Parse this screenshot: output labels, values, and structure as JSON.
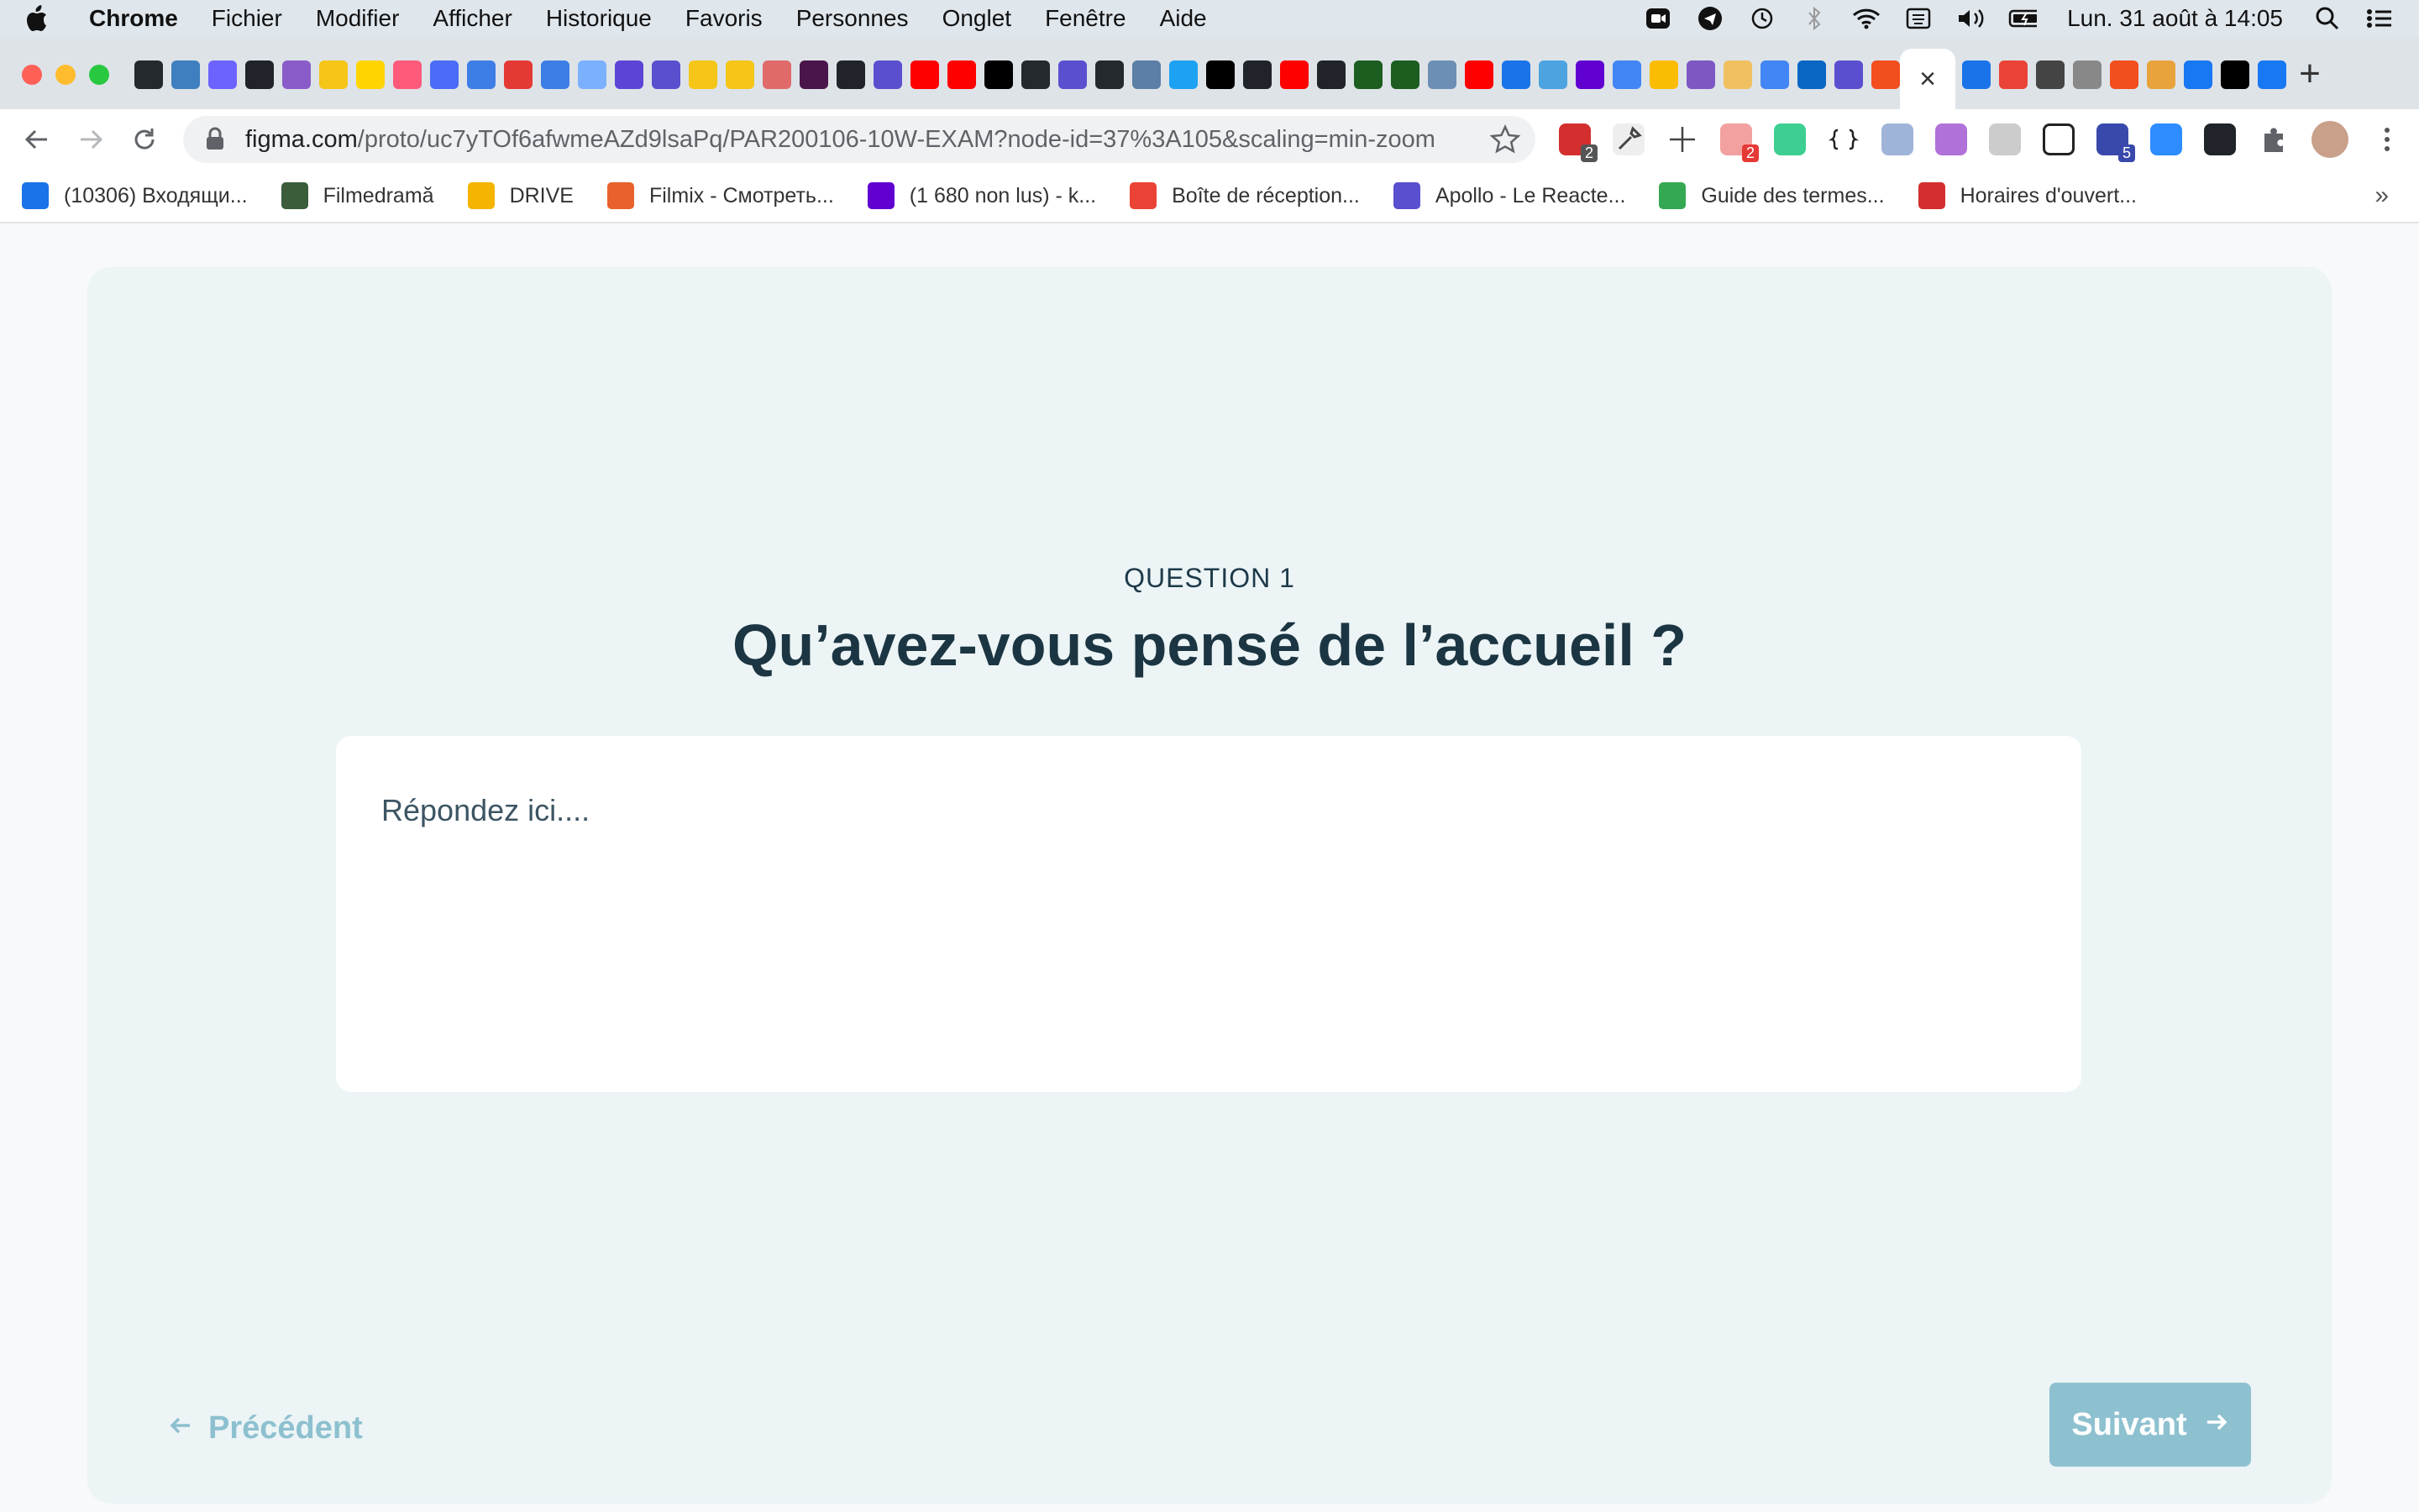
{
  "menubar": {
    "app_name": "Chrome",
    "items": [
      "Fichier",
      "Modifier",
      "Afficher",
      "Historique",
      "Favoris",
      "Personnes",
      "Onglet",
      "Fenêtre",
      "Aide"
    ],
    "clock": "Lun. 31 août à 14:05"
  },
  "browser": {
    "tab_close_glyph": "×",
    "new_tab_glyph": "+",
    "url_host": "figma.com",
    "url_path": "/proto/uc7yTOf6afwmeAZd9lsaPq/PAR200106-10W-EXAM?node-id=37%3A105&scaling=min-zoom",
    "ext_badges": [
      "2",
      "2",
      "5"
    ],
    "bookmarks_more": "»"
  },
  "bookmarks": [
    {
      "label": "(10306) Входящи...",
      "color": "#1a73e8"
    },
    {
      "label": "Filmedramă",
      "color": "#3b5d3a"
    },
    {
      "label": "DRIVE",
      "color": "#f4b400"
    },
    {
      "label": "Filmix - Смотреть...",
      "color": "#e8622c"
    },
    {
      "label": "(1 680 non lus) - k...",
      "color": "#6001d2"
    },
    {
      "label": "Boîte de réception...",
      "color": "#ea4335"
    },
    {
      "label": "Apollo - Le Reacte...",
      "color": "#5a4fcf"
    },
    {
      "label": "Guide des termes...",
      "color": "#34a853"
    },
    {
      "label": "Horaires d'ouvert...",
      "color": "#d32f2f"
    }
  ],
  "form": {
    "question_label": "QUESTION 1",
    "question_title": "Qu’avez-vous pensé de l’accueil ?",
    "answer_placeholder": "Répondez ici....",
    "answer_value": "",
    "prev_label": "Précédent",
    "next_label": "Suivant"
  },
  "colors": {
    "card_bg": "#ecf4f6",
    "title": "#1c3542",
    "accent": "#8ec1d0"
  }
}
